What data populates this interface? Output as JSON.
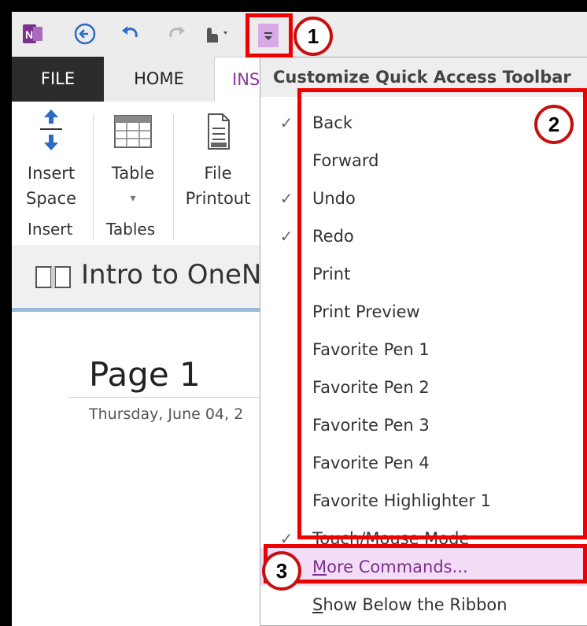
{
  "tabs": {
    "file": "FILE",
    "home": "HOME",
    "insert": "INS"
  },
  "ribbon": {
    "insert_space_line1": "Insert",
    "insert_space_line2": "Space",
    "table_label": "Table",
    "table_dropdown": "▾",
    "file_printout_line1": "File",
    "file_printout_line2": "Printout",
    "group_insert": "Insert",
    "group_tables": "Tables"
  },
  "page": {
    "tab_title": "Intro to OneN",
    "title": "Page 1",
    "date": "Thursday, June 04, 2"
  },
  "dropdown": {
    "header": "Customize Quick Access Toolbar",
    "items": [
      {
        "label": "Back",
        "checked": true
      },
      {
        "label": "Forward",
        "checked": false
      },
      {
        "label": "Undo",
        "checked": true
      },
      {
        "label": "Redo",
        "checked": true
      },
      {
        "label": "Print",
        "checked": false
      },
      {
        "label": "Print Preview",
        "checked": false
      },
      {
        "label": "Favorite Pen 1",
        "checked": false
      },
      {
        "label": "Favorite Pen 2",
        "checked": false
      },
      {
        "label": "Favorite Pen 3",
        "checked": false
      },
      {
        "label": "Favorite Pen 4",
        "checked": false
      },
      {
        "label": "Favorite Highlighter 1",
        "checked": false
      },
      {
        "label": "Touch/Mouse Mode",
        "checked": true
      }
    ],
    "check_glyph": "✓",
    "more_commands_first": "M",
    "more_commands_rest": "ore Commands...",
    "show_below_first": "S",
    "show_below_rest": "how Below the Ribbon"
  },
  "annotations": {
    "badge1": "1",
    "badge2": "2",
    "badge3": "3"
  },
  "colors": {
    "annotation_red": "#ee0000",
    "onenote_purple": "#7b2f8e",
    "accent_blue": "#2b6cc4"
  },
  "icons": [
    "onenote-logo-icon",
    "back-icon",
    "undo-icon",
    "redo-icon",
    "touch-mode-icon",
    "qat-dropdown-icon",
    "insert-space-icon",
    "table-icon",
    "file-printout-icon",
    "notebook-icon"
  ]
}
